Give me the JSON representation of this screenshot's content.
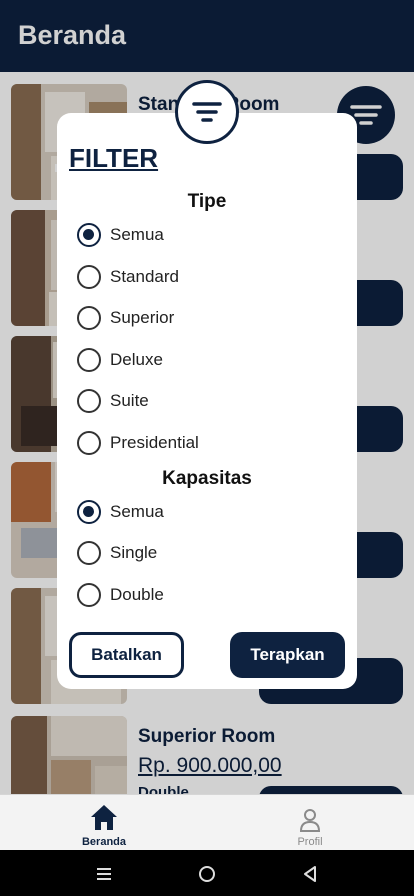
{
  "appbar": {
    "title": "Beranda"
  },
  "cards": [
    {
      "title": "Standard Room",
      "price": "",
      "capacity": ""
    },
    {
      "title": "",
      "price": "",
      "capacity": ""
    },
    {
      "title": "",
      "price": "",
      "capacity": ""
    },
    {
      "title": "",
      "price": "",
      "capacity": ""
    },
    {
      "title": "",
      "price": "",
      "capacity": ""
    },
    {
      "title": "Superior Room",
      "price": "Rp. 900.000,00",
      "capacity": "Double"
    }
  ],
  "filter": {
    "title": "FILTER",
    "type_group": {
      "title": "Tipe",
      "options": [
        "Semua",
        "Standard",
        "Superior",
        "Deluxe",
        "Suite",
        "Presidential"
      ],
      "selected": "Semua"
    },
    "capacity_group": {
      "title": "Kapasitas",
      "options": [
        "Semua",
        "Single",
        "Double"
      ],
      "selected": "Semua"
    },
    "cancel_label": "Batalkan",
    "apply_label": "Terapkan"
  },
  "bottom_nav": {
    "items": [
      {
        "label": "Beranda",
        "icon": "home-icon",
        "active": true
      },
      {
        "label": "Profil",
        "icon": "person-icon",
        "active": false
      }
    ]
  },
  "system_nav": {
    "icons": [
      "recent-apps-icon",
      "home-circle-icon",
      "back-icon"
    ]
  },
  "colors": {
    "primary": "#0e2240",
    "white": "#ffffff",
    "inactive": "#8a8a8a"
  }
}
